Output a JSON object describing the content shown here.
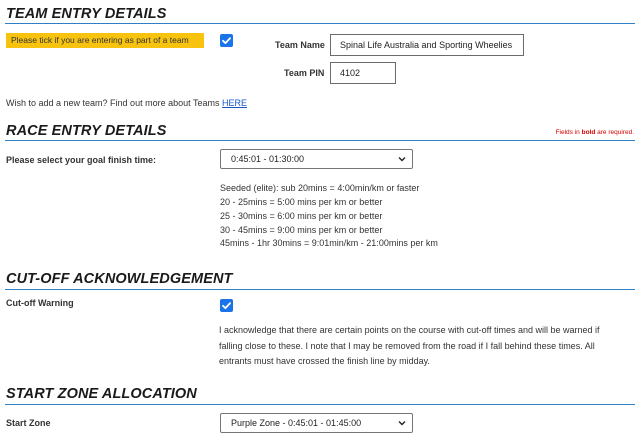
{
  "team_entry": {
    "title": "TEAM ENTRY DETAILS",
    "notice": "Please tick if you are entering as part of a team",
    "team_checkbox_checked": true,
    "team_name_label": "Team Name",
    "team_name_value": "Spinal Life Australia and Sporting Wheelies",
    "team_pin_label": "Team PIN",
    "team_pin_value": "4102",
    "new_team_text": "Wish to add a new team? Find out more about Teams",
    "new_team_link": "HERE"
  },
  "race_entry": {
    "title": "RACE ENTRY DETAILS",
    "required_note_prefix": "Fields in",
    "required_note_bold": "bold",
    "required_note_suffix": "are required.",
    "goal_label": "Please select your goal finish time:",
    "goal_selected": "0:45:01 - 01:30:00",
    "pace_lines": [
      "Seeded (elite): sub 20mins = 4:00min/km or faster",
      "20 - 25mins = 5:00 mins per km or better",
      "25 - 30mins = 6:00 mins per km or better",
      "30 - 45mins = 9:00 mins per km or better",
      "45mins - 1hr 30mins = 9:01min/km - 21:00mins per km"
    ]
  },
  "cutoff": {
    "title": "CUT-OFF ACKNOWLEDGEMENT",
    "warning_label": "Cut-off Warning",
    "checkbox_checked": true,
    "acknowledgement": "I acknowledge that there are certain points on the course with cut-off times and will be warned if falling close to these. I note that I may be removed from the road if I fall behind these times. All entrants must have crossed the finish line by midday."
  },
  "start_zone": {
    "title": "START ZONE ALLOCATION",
    "zone_label": "Start Zone",
    "zone_selected": "Purple Zone - 0:45:01 - 01:45:00"
  },
  "colors": {
    "accent_rule": "#2f7fc4",
    "notice_bg": "#f7c30f",
    "checkbox": "#1a73e8",
    "required_text": "#d00000",
    "link": "#1a55c8"
  }
}
